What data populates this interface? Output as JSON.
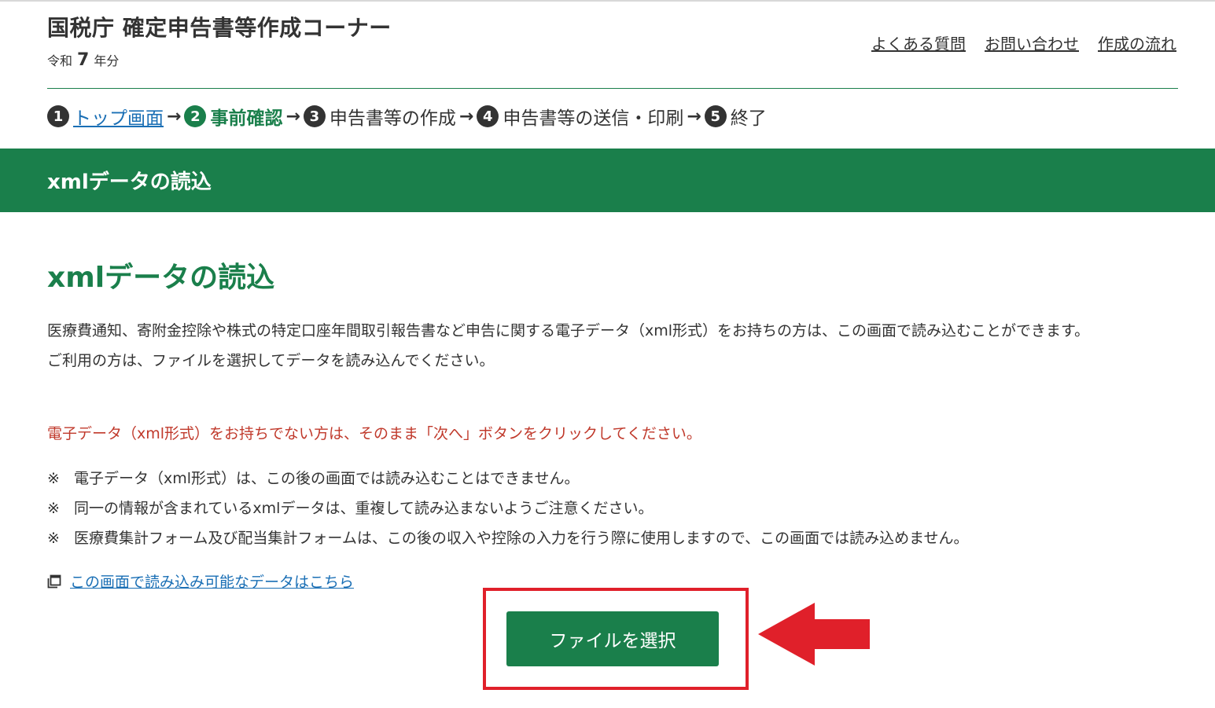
{
  "header": {
    "site_title": "国税庁 確定申告書等作成コーナー",
    "year_prefix": "令和",
    "year_number": "7",
    "year_suffix": "年分",
    "links": [
      "よくある質問",
      "お問い合わせ",
      "作成の流れ"
    ]
  },
  "steps": [
    {
      "num": "1",
      "label": "トップ画面",
      "state": "link"
    },
    {
      "num": "2",
      "label": "事前確認",
      "state": "current"
    },
    {
      "num": "3",
      "label": "申告書等の作成",
      "state": "normal"
    },
    {
      "num": "4",
      "label": "申告書等の送信・印刷",
      "state": "normal"
    },
    {
      "num": "5",
      "label": "終了",
      "state": "normal"
    }
  ],
  "step_arrow": "→",
  "banner": {
    "title": "xmlデータの読込"
  },
  "main": {
    "heading": "xmlデータの読込",
    "intro_line1": "医療費通知、寄附金控除や株式の特定口座年間取引報告書など申告に関する電子データ（xml形式）をお持ちの方は、この画面で読み込むことができます。",
    "intro_line2": "ご利用の方は、ファイルを選択してデータを読み込んでください。",
    "warning": "電子データ（xml形式）をお持ちでない方は、そのまま「次へ」ボタンをクリックしてください。",
    "note_mark": "※",
    "notes": [
      "電子データ（xml形式）は、この後の画面では読み込むことはできません。",
      "同一の情報が含まれているxmlデータは、重複して読み込まないようご注意ください。",
      "医療費集計フォーム及び配当集計フォームは、この後の収入や控除の入力を行う際に使用しますので、この画面では読み込めません。"
    ],
    "data_link": "この画面で読み込み可能なデータはこちら",
    "file_button": "ファイルを選択"
  },
  "colors": {
    "brand_green": "#1a7f4b",
    "link_blue": "#1a6fb5",
    "warning_red": "#c0392b",
    "annotation_red": "#e0202a"
  },
  "icons": {
    "data_link": "new-window-icon",
    "annotation": "red-arrow-left"
  }
}
